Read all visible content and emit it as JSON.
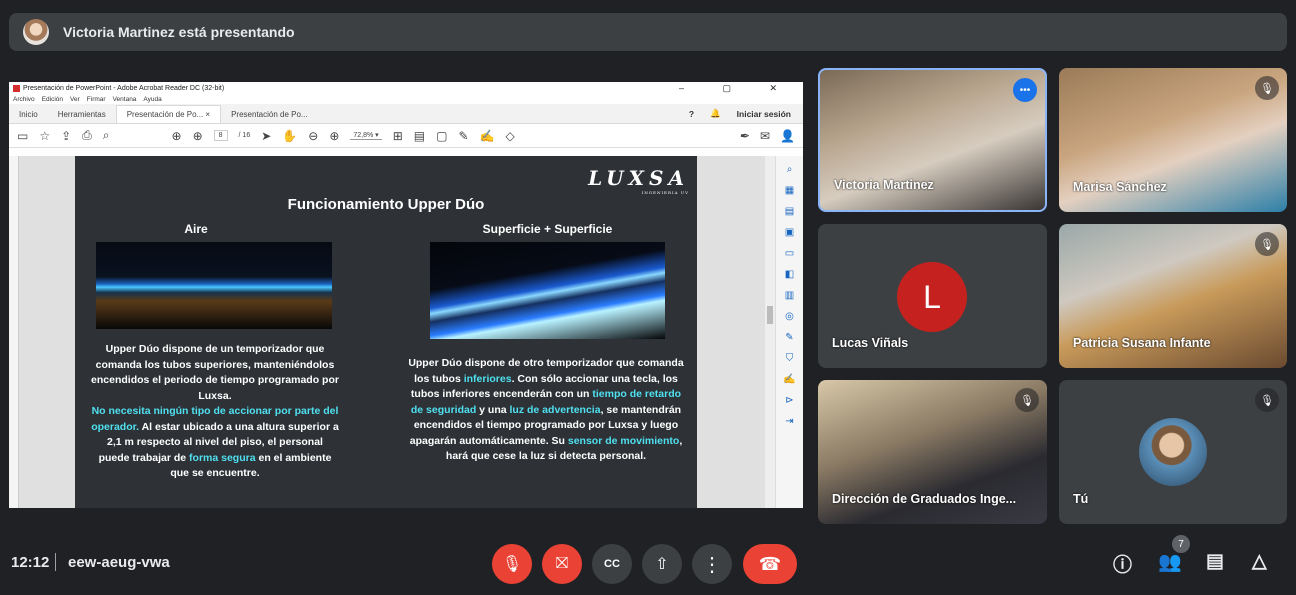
{
  "banner": {
    "text": "Victoria Martinez está presentando"
  },
  "acrobat": {
    "title": "Presentación de PowerPoint - Adobe Acrobat Reader DC (32-bit)",
    "window_controls": "–  ▢  ✕",
    "menu": [
      "Archivo",
      "Edición",
      "Ver",
      "Firmar",
      "Ventana",
      "Ayuda"
    ],
    "tabs": {
      "home": "Inicio",
      "tools": "Herramientas",
      "doc1": "Presentación de Po... ×",
      "doc2": "Presentación de Po..."
    },
    "help": "?",
    "bell": "🔔",
    "signin": "Iniciar sesión",
    "page_current": "8",
    "page_total": "/ 16",
    "zoom": "72,8%  ▾"
  },
  "slide": {
    "logo": "LUXSA",
    "logo_sub": "INGENIERIA UV",
    "title": "Funcionamiento Upper Dúo",
    "col1_title": "Aire",
    "col2_title": "Superficie + Superficie",
    "col1_text": {
      "a": "Upper Dúo dispone de un temporizador que comanda los tubos superiores, manteniéndolos encendidos el periodo de tiempo programado por Luxsa.",
      "b": "No necesita ningún tipo de accionar por parte del operador.",
      "c": " Al estar ubicado a una altura superior a 2,1 m respecto al nivel del piso, el personal puede trabajar de ",
      "d": "forma segura",
      "e": " en el ambiente que se encuentre."
    },
    "col2_text": {
      "a": "Upper Dúo dispone de otro temporizador que comanda los tubos ",
      "b": "inferiores",
      "c": ". Con sólo accionar una tecla, los tubos inferiores encenderán con un ",
      "d": "tiempo de retardo de seguridad",
      "e": " y una ",
      "f": "luz de advertencia",
      "g": ", se mantendrán encendidos el tiempo programado por Luxsa y luego apagarán automáticamente. Su ",
      "h": "sensor de movimiento",
      "i": ", hará que cese la luz si detecta personal."
    }
  },
  "participants": [
    {
      "name": "Victoria Martinez"
    },
    {
      "name": "Marisa Sánchez"
    },
    {
      "name": "Lucas Viñals",
      "initial": "L"
    },
    {
      "name": "Patricia Susana Infante"
    },
    {
      "name": "Dirección de Graduados Inge..."
    },
    {
      "name": "Tú"
    }
  ],
  "bottom": {
    "time": "12:12",
    "meeting_code": "eew-aeug-vwa",
    "people_count": "7"
  },
  "colors": {
    "end_call": "#ea4335",
    "speaking": "#1a73e8",
    "avatar_L": "#c5221f",
    "highlight": "#4fe0f0"
  }
}
